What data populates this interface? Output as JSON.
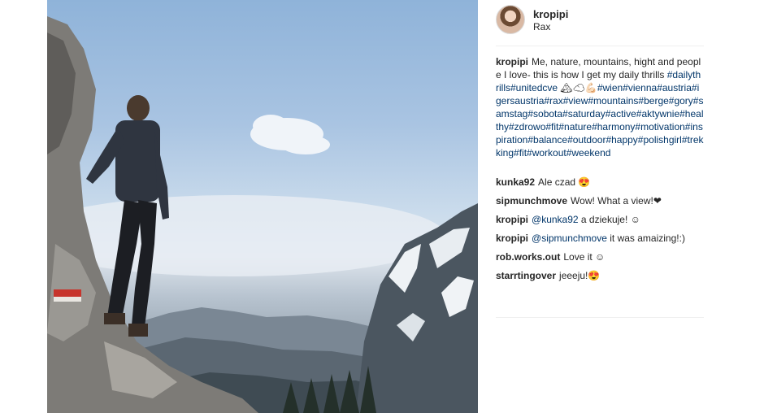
{
  "post": {
    "username": "kropipi",
    "location": "Rax",
    "caption_text": "Me, nature, mountains, hight and people I love- this is how I get my daily thrills",
    "caption_tags_1": "#dailythrills#unitedcve",
    "caption_emoji": "🏔☁💪🏻",
    "caption_tags_2": "#wien#vienna#austria#igersaustria#rax#view#mountains#berge#gory#samstag#sobota#saturday#active#aktywnie#healthy#zdrowo#fit#nature#harmony#motivation#inspiration#balance#outdoor#happy#polishgirl#trekking#fit#workout#weekend"
  },
  "comments": [
    {
      "username": "kunka92",
      "text": "Ale czad 😍",
      "mention": ""
    },
    {
      "username": "sipmunchmove",
      "text": "Wow! What a view!❤",
      "mention": ""
    },
    {
      "username": "kropipi",
      "mention": "@kunka92",
      "text": "a dziekuje! ☺"
    },
    {
      "username": "kropipi",
      "mention": "@sipmunchmove",
      "text": "it was amaizing!:)"
    },
    {
      "username": "rob.works.out",
      "text": "Love it ☺",
      "mention": ""
    },
    {
      "username": "starrtingover",
      "text": "jeeeju!😍",
      "mention": ""
    }
  ]
}
